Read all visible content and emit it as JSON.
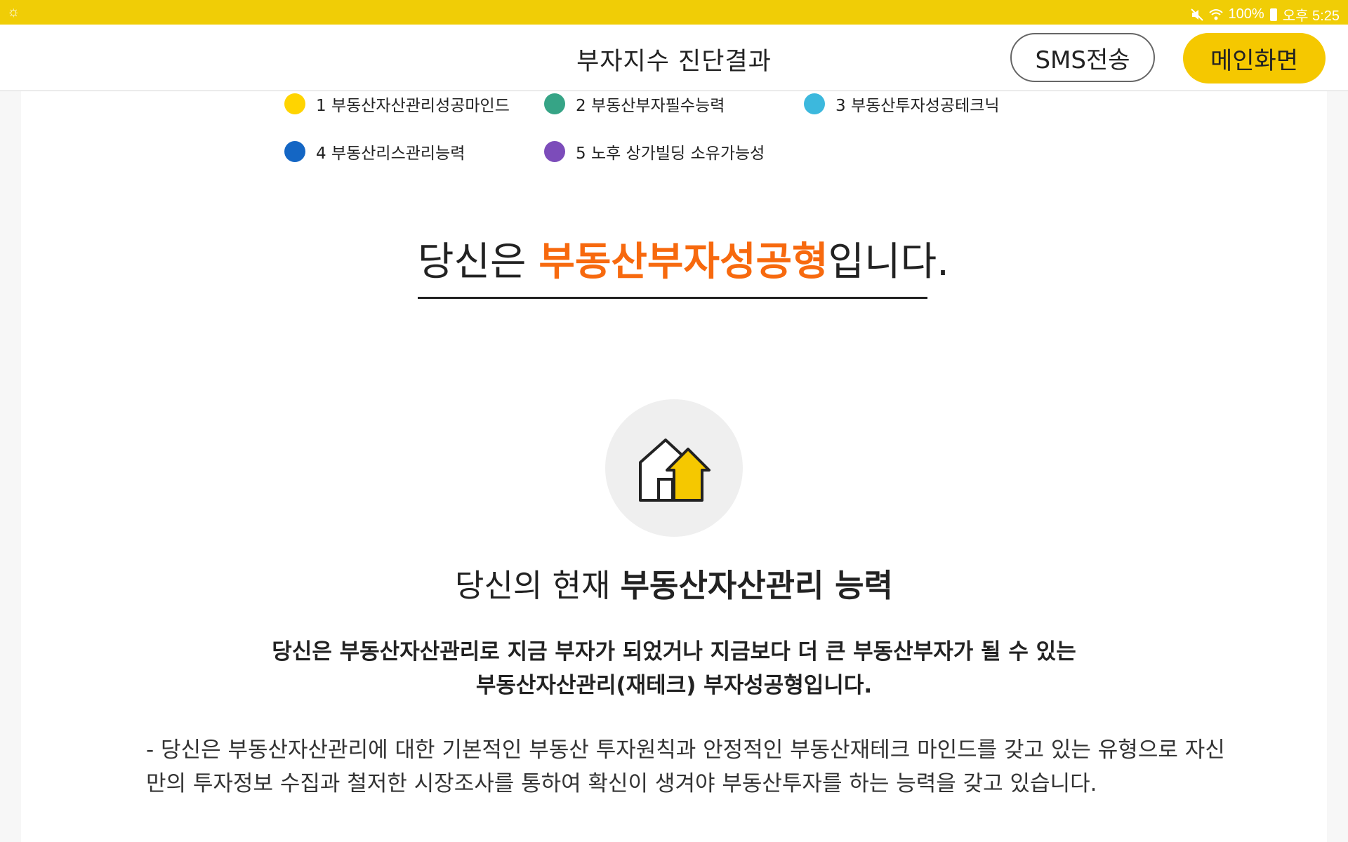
{
  "status_bar": {
    "left_icon": "sun-icon",
    "mute_icon": "mute-icon",
    "wifi_icon": "wifi-icon",
    "battery_text": "100%",
    "time": "오후 5:25"
  },
  "header": {
    "title": "부자지수 진단결과",
    "sms_button": "SMS전송",
    "main_button": "메인화면"
  },
  "legend": [
    {
      "label": "1 부동산자산관리성공마인드",
      "color": "#ffd400"
    },
    {
      "label": "2 부동산부자필수능력",
      "color": "#36a486"
    },
    {
      "label": "3 부동산투자성공테크닉",
      "color": "#3cb8dd"
    },
    {
      "label": "4 부동산리스관리능력",
      "color": "#1466c4"
    },
    {
      "label": "5 노후 상가빌딩 소유가능성",
      "color": "#7c4cba"
    }
  ],
  "result": {
    "prefix": "당신은 ",
    "type": "부동산부자성공형",
    "suffix": "입니다.",
    "accent_color": "#f7690e"
  },
  "ability": {
    "icon": "house-arrow-up-icon",
    "prefix": "당신의 현재 ",
    "name": "부동산자산관리 능력"
  },
  "summary": {
    "line1": "당신은 부동산자산관리로 지금 부자가 되었거나 지금보다 더 큰 부동산부자가 될 수 있는",
    "line2": "부동산자산관리(재테크) 부자성공형입니다."
  },
  "description": {
    "p1": "- 당신은 부동산자산관리에 대한 기본적인 부동산 투자원칙과 안정적인 부동산재테크 마인드를 갖고 있는 유형으로 자신만의 투자정보 수집과 철저한 시장조사를 통하여 확신이 생겨야 부동산투자를 하는 능력을 갖고 있습니다."
  }
}
